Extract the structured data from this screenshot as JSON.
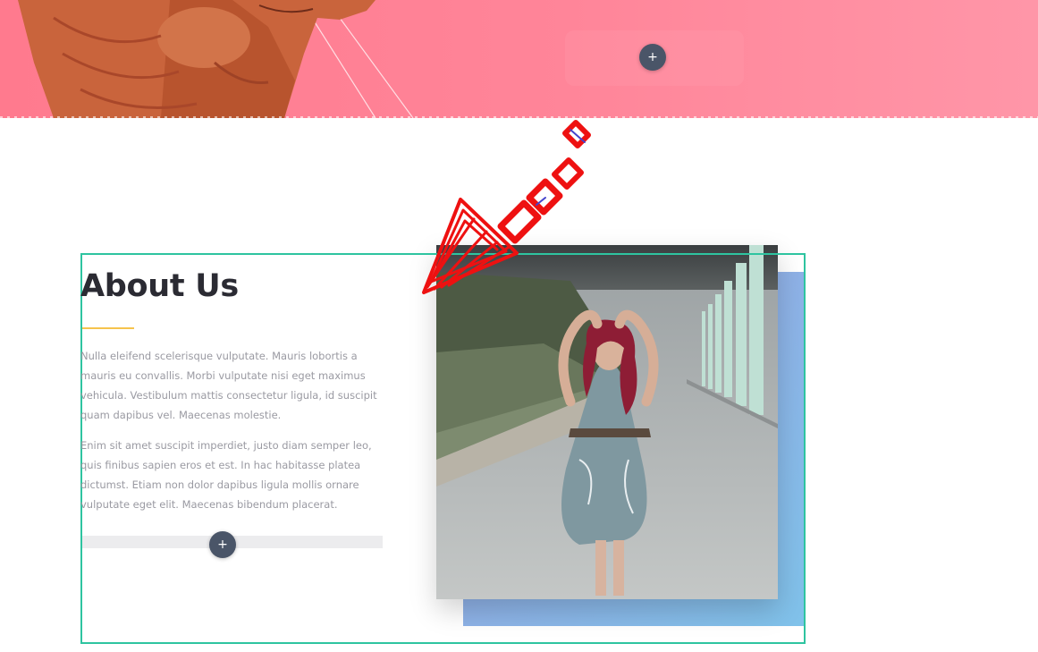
{
  "hero": {
    "add_button_label": "+"
  },
  "about": {
    "title": "About Us",
    "paragraphs": [
      "Nulla eleifend scelerisque vulputate. Mauris lobortis a mauris eu convallis. Morbi vulputate nisi eget maximus vehicula. Vestibulum mattis consectetur ligula, id suscipit quam dapibus vel. Maecenas molestie.",
      "Enim sit amet suscipit imperdiet, justo diam semper leo, quis finibus sapien eros et est. In hac habitasse platea dictumst. Etiam non dolor dapibus ligula mollis ornare vulputate eget elit. Maecenas bibendum placerat."
    ],
    "add_button_label": "+"
  },
  "colors": {
    "hero_pink": "#ff7f92",
    "selection_outline": "#2ec4a0",
    "title_underline": "#f6c34d",
    "accent_gradient": [
      "#a996e6",
      "#80c2ea"
    ],
    "annotation_arrow": "#ee1111",
    "add_button": "#4a5568"
  },
  "icons": {
    "add": "plus-icon",
    "annotation": "arrow-pointer-icon"
  }
}
